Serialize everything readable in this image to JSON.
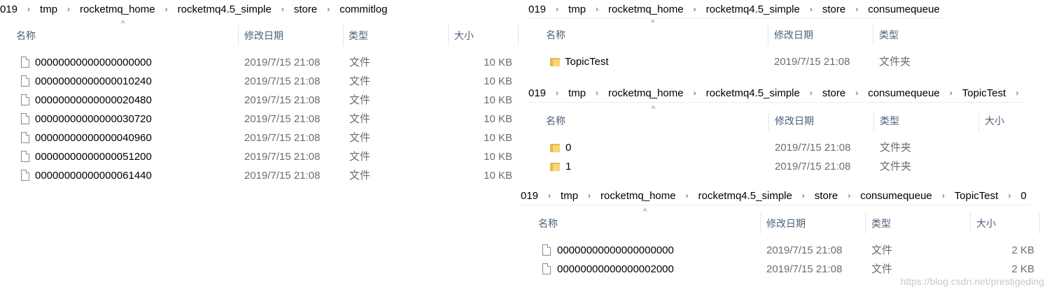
{
  "left": {
    "breadcrumb": [
      "019",
      "tmp",
      "rocketmq_home",
      "rocketmq4.5_simple",
      "store",
      "commitlog"
    ],
    "columns": {
      "name": "名称",
      "date": "修改日期",
      "type": "类型",
      "size": "大小"
    },
    "rows": [
      {
        "name": "00000000000000000000",
        "date": "2019/7/15 21:08",
        "type": "文件",
        "size": "10 KB"
      },
      {
        "name": "00000000000000010240",
        "date": "2019/7/15 21:08",
        "type": "文件",
        "size": "10 KB"
      },
      {
        "name": "00000000000000020480",
        "date": "2019/7/15 21:08",
        "type": "文件",
        "size": "10 KB"
      },
      {
        "name": "00000000000000030720",
        "date": "2019/7/15 21:08",
        "type": "文件",
        "size": "10 KB"
      },
      {
        "name": "00000000000000040960",
        "date": "2019/7/15 21:08",
        "type": "文件",
        "size": "10 KB"
      },
      {
        "name": "00000000000000051200",
        "date": "2019/7/15 21:08",
        "type": "文件",
        "size": "10 KB"
      },
      {
        "name": "00000000000000061440",
        "date": "2019/7/15 21:08",
        "type": "文件",
        "size": "10 KB"
      }
    ]
  },
  "right1": {
    "breadcrumb": [
      "019",
      "tmp",
      "rocketmq_home",
      "rocketmq4.5_simple",
      "store",
      "consumequeue"
    ],
    "columns": {
      "name": "名称",
      "date": "修改日期",
      "type": "类型"
    },
    "rows": [
      {
        "name": "TopicTest",
        "date": "2019/7/15 21:08",
        "type": "文件夹"
      }
    ]
  },
  "right2": {
    "breadcrumb": [
      "019",
      "tmp",
      "rocketmq_home",
      "rocketmq4.5_simple",
      "store",
      "consumequeue",
      "TopicTest"
    ],
    "columns": {
      "name": "名称",
      "date": "修改日期",
      "type": "类型",
      "size": "大小"
    },
    "rows": [
      {
        "name": "0",
        "date": "2019/7/15 21:08",
        "type": "文件夹"
      },
      {
        "name": "1",
        "date": "2019/7/15 21:08",
        "type": "文件夹"
      }
    ]
  },
  "right3": {
    "breadcrumb": [
      "019",
      "tmp",
      "rocketmq_home",
      "rocketmq4.5_simple",
      "store",
      "consumequeue",
      "TopicTest",
      "0"
    ],
    "columns": {
      "name": "名称",
      "date": "修改日期",
      "type": "类型",
      "size": "大小"
    },
    "rows": [
      {
        "name": "00000000000000000000",
        "date": "2019/7/15 21:08",
        "type": "文件",
        "size": "2 KB"
      },
      {
        "name": "00000000000000002000",
        "date": "2019/7/15 21:08",
        "type": "文件",
        "size": "2 KB"
      }
    ]
  },
  "watermark": "https://blog.csdn.net/prestigeding",
  "colors": {
    "header_text": "#4c607a",
    "folder": "#f8d775",
    "secondary_text": "#6d6d6d"
  },
  "icons": {
    "file": "file-icon",
    "folder": "folder-icon",
    "separator": "chevron-right-icon",
    "sort": "sort-caret-icon"
  }
}
